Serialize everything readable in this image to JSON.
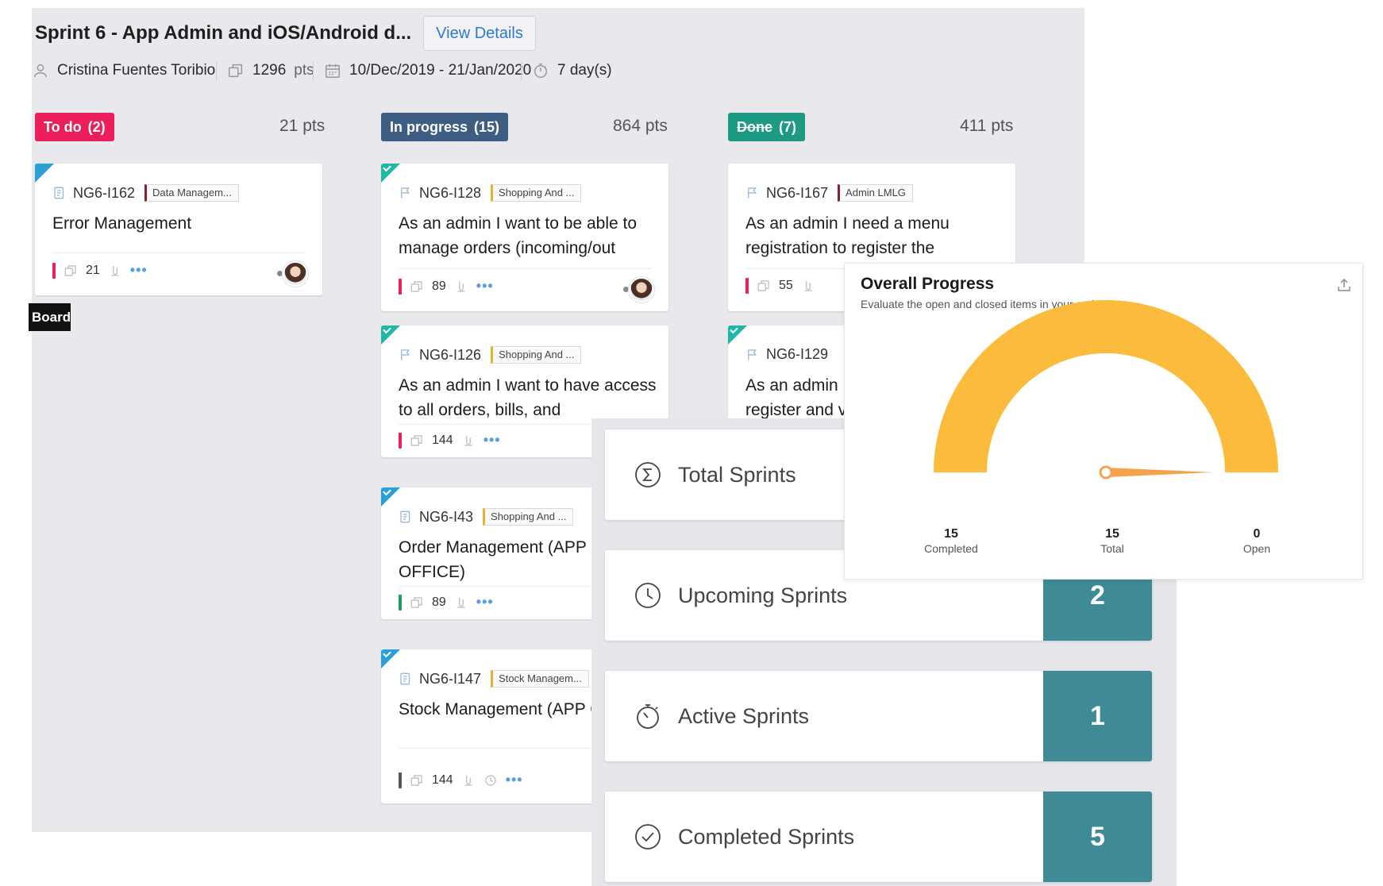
{
  "sprint": {
    "title": "Sprint 6 - App Admin and iOS/Android d...",
    "view_details_label": "View Details",
    "owner": "Cristina Fuentes Toribio",
    "points": "1296",
    "points_unit": "pts",
    "date_range": "10/Dec/2019 - 21/Jan/2020",
    "duration": "7 day(s)"
  },
  "columns": [
    {
      "label": "To do",
      "count": "(2)",
      "points": "21 pts",
      "color": "#ed1f5b",
      "cards": [
        {
          "id": "NG6-I162",
          "tag": "Data Managem...",
          "title": "Error Management",
          "points": "21"
        }
      ]
    },
    {
      "label": "In progress",
      "count": "(15)",
      "points": "864 pts",
      "color": "#3d5d83",
      "cards": [
        {
          "id": "NG6-I128",
          "tag": "Shopping And ...",
          "title": "As an admin I want to be able to manage orders (incoming/out",
          "points": "89"
        },
        {
          "id": "NG6-I126",
          "tag": "Shopping And ...",
          "title": "As an admin I want to have access to all orders, bills, and",
          "points": "144"
        },
        {
          "id": "NG6-I43",
          "tag": "Shopping And ...",
          "title": "Order Management (APP OFFICE)",
          "points": "89"
        },
        {
          "id": "NG6-I147",
          "tag": "Stock Managem...",
          "title": "Stock Management (APP CLIENT)",
          "points": "144"
        }
      ]
    },
    {
      "label": "Done",
      "count": "(7)",
      "points": "411 pts",
      "color": "#1d9a84",
      "cards": [
        {
          "id": "NG6-I167",
          "tag": "Admin LMLG",
          "title": "As an admin I need a menu registration to register the",
          "points": "55"
        },
        {
          "id": "NG6-I129",
          "tag": "",
          "title": "As an admin I register and v",
          "points": ""
        }
      ]
    }
  ],
  "board_tag": "Board",
  "stats": [
    {
      "label": "Total Sprints",
      "value": "",
      "icon": "sigma-icon"
    },
    {
      "label": "Upcoming Sprints",
      "value": "2",
      "icon": "clock-icon"
    },
    {
      "label": "Active Sprints",
      "value": "1",
      "icon": "timer-icon"
    },
    {
      "label": "Completed Sprints",
      "value": "5",
      "icon": "check-circle-icon"
    }
  ],
  "progress": {
    "title": "Overall Progress",
    "subtitle": "Evaluate the open and closed items in your sprint.",
    "completed_value": "15",
    "completed_label": "Completed",
    "total_value": "15",
    "total_label": "Total",
    "open_value": "0",
    "open_label": "Open",
    "completed_fraction": 1.0,
    "gauge_color": "#fbbc3d",
    "needle_color": "#f4a24c"
  }
}
